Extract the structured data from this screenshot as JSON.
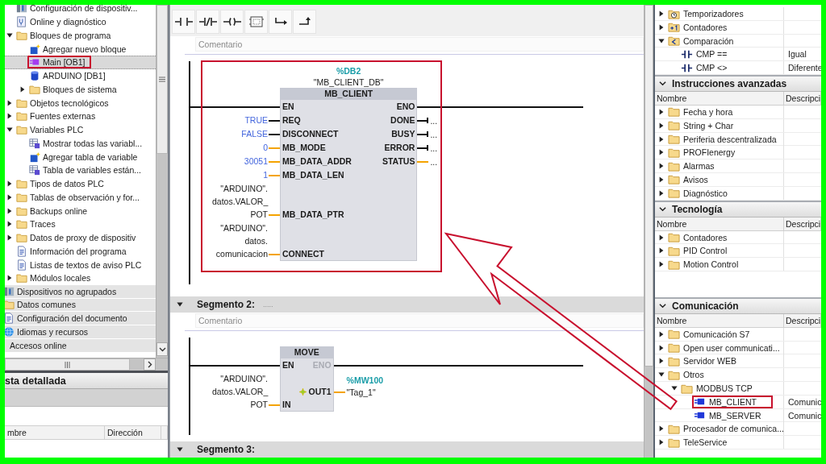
{
  "project_tree": {
    "items": [
      {
        "label": "Configuración de dispositiv...",
        "kind": "device",
        "selected": false
      },
      {
        "label": "Online y diagnóstico",
        "kind": "diag",
        "selected": false
      },
      {
        "label": "Bloques de programa",
        "kind": "folder",
        "expanded": true,
        "selected": false,
        "children": [
          {
            "label": "Agregar nuevo bloque",
            "kind": "add",
            "selected": false
          },
          {
            "label": "Main [OB1]",
            "kind": "ob",
            "selected": true,
            "highlighted": true
          },
          {
            "label": "ARDUINO [DB1]",
            "kind": "db",
            "selected": false
          },
          {
            "label": "Bloques de sistema",
            "kind": "folder",
            "expanded": false,
            "selected": false
          }
        ]
      },
      {
        "label": "Objetos tecnológicos",
        "kind": "folder",
        "expanded": false,
        "selected": false
      },
      {
        "label": "Fuentes externas",
        "kind": "folder",
        "expanded": false,
        "selected": false
      },
      {
        "label": "Variables PLC",
        "kind": "folder",
        "expanded": true,
        "selected": false,
        "children": [
          {
            "label": "Mostrar todas las variabl...",
            "kind": "table",
            "selected": false
          },
          {
            "label": "Agregar tabla de variable",
            "kind": "add",
            "selected": false
          },
          {
            "label": "Tabla de variables están...",
            "kind": "table",
            "selected": false
          }
        ]
      },
      {
        "label": "Tipos de datos PLC",
        "kind": "folder",
        "expanded": false,
        "selected": false
      },
      {
        "label": "Tablas de observación y for...",
        "kind": "folder",
        "expanded": false,
        "selected": false
      },
      {
        "label": "Backups online",
        "kind": "folder",
        "expanded": false,
        "selected": false
      },
      {
        "label": "Traces",
        "kind": "folder",
        "expanded": false,
        "selected": false
      },
      {
        "label": "Datos de proxy de dispositiv",
        "kind": "folder",
        "expanded": false,
        "selected": false
      },
      {
        "label": "Información del programa",
        "kind": "doc",
        "selected": false
      },
      {
        "label": "Listas de textos de aviso PLC",
        "kind": "doc",
        "selected": false
      },
      {
        "label": "Módulos locales",
        "kind": "folder",
        "expanded": false,
        "selected": false
      }
    ],
    "root_items": [
      {
        "label": "Dispositivos no agrupados",
        "kind": "device",
        "selected": false
      },
      {
        "label": "Datos comunes",
        "kind": "folder",
        "selected": false
      },
      {
        "label": "Configuración del documento",
        "kind": "doc",
        "selected": false
      },
      {
        "label": "Idiomas y recursos",
        "kind": "globe",
        "selected": false
      },
      {
        "label": "Accesos online",
        "selected": false
      }
    ]
  },
  "detail_view": {
    "title": "sta detallada",
    "columns": [
      "mbre",
      "Dirección"
    ]
  },
  "editor": {
    "toolbar": [
      {
        "kind": "no-contact"
      },
      {
        "kind": "nc-contact"
      },
      {
        "kind": "coil"
      },
      {
        "kind": "box"
      },
      {
        "kind": "branch-open"
      },
      {
        "kind": "branch-close"
      }
    ],
    "segments": [
      {
        "placeholder": "Comentario",
        "block": {
          "name": "MB_CLIENT",
          "highlighted": true,
          "instance": {
            "address": "%DB2",
            "name": "\"MB_CLIENT_DB\""
          },
          "inputs": [
            {
              "pin": "EN",
              "kind": "power"
            },
            {
              "pin": "REQ",
              "kind": "bool",
              "constant": true,
              "value": [
                "TRUE"
              ]
            },
            {
              "pin": "DISCONNECT",
              "kind": "bool",
              "constant": true,
              "value": [
                "FALSE"
              ]
            },
            {
              "pin": "MB_MODE",
              "kind": "data",
              "constant": true,
              "value": [
                "0"
              ]
            },
            {
              "pin": "MB_DATA_ADDR",
              "kind": "data",
              "constant": true,
              "value": [
                "30051"
              ]
            },
            {
              "pin": "MB_DATA_LEN",
              "kind": "data",
              "constant": true,
              "value": [
                "1"
              ]
            },
            {
              "pin": "MB_DATA_PTR",
              "kind": "data",
              "constant": false,
              "value": [
                "\"ARDUINO\".",
                "datos.VALOR_",
                "POT"
              ]
            },
            {
              "pin": "CONNECT",
              "kind": "data",
              "constant": false,
              "value": [
                "\"ARDUINO\".",
                "datos.",
                "comunicacion"
              ]
            }
          ],
          "outputs": [
            {
              "pin": "ENO",
              "kind": "power",
              "disabled": false
            },
            {
              "pin": "DONE",
              "kind": "bool",
              "value": "..."
            },
            {
              "pin": "BUSY",
              "kind": "bool",
              "value": "..."
            },
            {
              "pin": "ERROR",
              "kind": "bool",
              "value": "..."
            },
            {
              "pin": "STATUS",
              "kind": "data",
              "value": "..."
            }
          ]
        }
      },
      {
        "title": "Segmento 2:",
        "subtitle": ".....",
        "expanded": true,
        "placeholder": "Comentario",
        "block": {
          "name": "MOVE",
          "highlighted": false,
          "inputs": [
            {
              "pin": "EN",
              "kind": "power"
            },
            {
              "pin": "IN",
              "kind": "data",
              "constant": false,
              "value": [
                "\"ARDUINO\".",
                "datos.VALOR_",
                "POT"
              ]
            }
          ],
          "outputs": [
            {
              "pin": "ENO",
              "kind": "power",
              "disabled": true
            },
            {
              "pin": "OUT1",
              "kind": "data",
              "extensible": true,
              "address": "%MW100",
              "value": "\"Tag_1\""
            }
          ]
        }
      },
      {
        "title": "Segmento 3:",
        "expanded": true
      }
    ]
  },
  "instructions": {
    "sections": [
      {
        "items": [
          {
            "label": "Temporizadores",
            "kind": "timer",
            "expanded": false
          },
          {
            "label": "Contadores",
            "kind": "counter",
            "expanded": false
          },
          {
            "label": "Comparación",
            "kind": "compare",
            "expanded": true,
            "children": [
              {
                "label": "CMP ==",
                "kind": "contact",
                "description": "Igual"
              },
              {
                "label": "CMP <>",
                "kind": "contact",
                "description": "Diferente"
              }
            ]
          }
        ]
      },
      {
        "title": "Instrucciones avanzadas",
        "expanded": true,
        "columns": [
          "Nombre",
          "Descripci"
        ],
        "items": [
          {
            "label": "Fecha y hora",
            "kind": "folder",
            "expanded": false
          },
          {
            "label": "String + Char",
            "kind": "folder",
            "expanded": false
          },
          {
            "label": "Periferia descentralizada",
            "kind": "folder",
            "expanded": false
          },
          {
            "label": "PROFIenergy",
            "kind": "folder",
            "expanded": false
          },
          {
            "label": "Alarmas",
            "kind": "folder",
            "expanded": false
          },
          {
            "label": "Avisos",
            "kind": "folder",
            "expanded": false
          },
          {
            "label": "Diagnóstico",
            "kind": "folder",
            "expanded": false
          }
        ]
      },
      {
        "title": "Tecnología",
        "expanded": true,
        "columns": [
          "Nombre",
          "Descripci"
        ],
        "items": [
          {
            "label": "Contadores",
            "kind": "folder",
            "expanded": false
          },
          {
            "label": "PID Control",
            "kind": "folder",
            "expanded": false
          },
          {
            "label": "Motion Control",
            "kind": "folder",
            "expanded": false
          }
        ]
      },
      {
        "title": "Comunicación",
        "expanded": true,
        "columns": [
          "Nombre",
          "Descripci"
        ],
        "items": [
          {
            "label": "Comunicación S7",
            "kind": "folder",
            "expanded": false
          },
          {
            "label": "Open user communicati...",
            "kind": "folder",
            "expanded": false
          },
          {
            "label": "Servidor WEB",
            "kind": "folder",
            "expanded": false
          },
          {
            "label": "Otros",
            "kind": "folder",
            "expanded": true,
            "children": [
              {
                "label": "MODBUS TCP",
                "kind": "folder",
                "expanded": true,
                "children": [
                  {
                    "label": "MB_CLIENT",
                    "kind": "fb",
                    "description": "Comunic",
                    "highlighted": true
                  },
                  {
                    "label": "MB_SERVER",
                    "kind": "fb",
                    "description": "Comunic"
                  }
                ]
              }
            ]
          },
          {
            "label": "Procesador de comunica...",
            "kind": "folder",
            "expanded": false
          },
          {
            "label": "TeleService",
            "kind": "folder",
            "expanded": false
          }
        ]
      }
    ]
  }
}
